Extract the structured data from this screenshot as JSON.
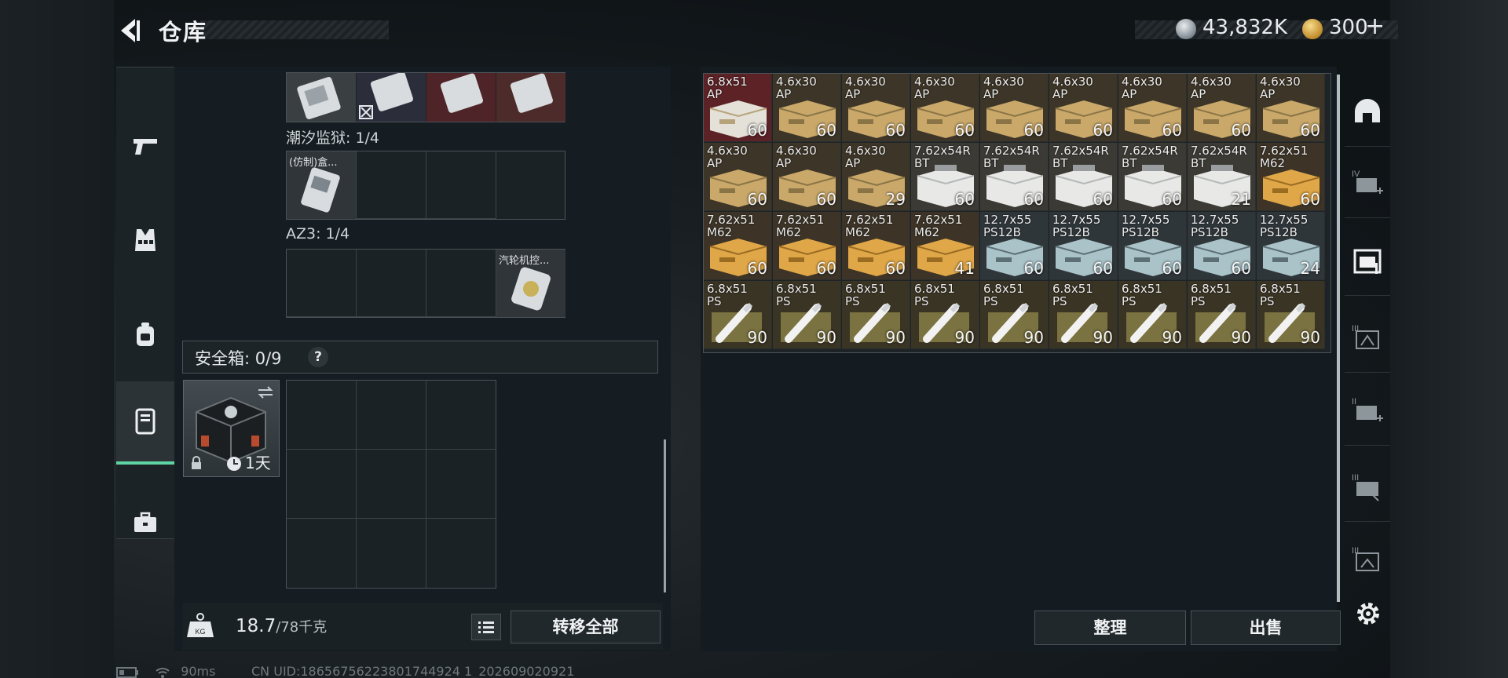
{
  "header": {
    "title": "仓库",
    "currency_silver": "43,832K",
    "currency_gold": "300",
    "gold_plus": "+"
  },
  "containers": {
    "tide_prison_label": "潮汐监狱: 1/4",
    "tide_item_label": "(仿制)盒...",
    "az3_label": "AZ3: 1/4",
    "az3_item_label": "汽轮机控..."
  },
  "safe_box": {
    "label": "安全箱: 0/9",
    "help": "?",
    "timer": "1天"
  },
  "bottom_left": {
    "weight_current": "18.7",
    "weight_max": "/78千克",
    "kg_badge": "KG",
    "transfer_all": "转移全部"
  },
  "bottom_right": {
    "organize": "整理",
    "sell": "出售"
  },
  "status": {
    "ping": "90ms",
    "uid": "CN UID:18656756223801744924 1_202609020921"
  },
  "stash": {
    "rows": [
      [
        {
          "cal": "6.8x51",
          "sub": "AP",
          "count": "60",
          "kind": "red"
        },
        {
          "cal": "4.6x30",
          "sub": "AP",
          "count": "60",
          "kind": "tan"
        },
        {
          "cal": "4.6x30",
          "sub": "AP",
          "count": "60",
          "kind": "tan"
        },
        {
          "cal": "4.6x30",
          "sub": "AP",
          "count": "60",
          "kind": "tan"
        },
        {
          "cal": "4.6x30",
          "sub": "AP",
          "count": "60",
          "kind": "tan"
        },
        {
          "cal": "4.6x30",
          "sub": "AP",
          "count": "60",
          "kind": "tan"
        },
        {
          "cal": "4.6x30",
          "sub": "AP",
          "count": "60",
          "kind": "tan"
        },
        {
          "cal": "4.6x30",
          "sub": "AP",
          "count": "60",
          "kind": "tan"
        },
        {
          "cal": "4.6x30",
          "sub": "AP",
          "count": "60",
          "kind": "tan"
        }
      ],
      [
        {
          "cal": "4.6x30",
          "sub": "AP",
          "count": "60",
          "kind": "tan"
        },
        {
          "cal": "4.6x30",
          "sub": "AP",
          "count": "60",
          "kind": "tan"
        },
        {
          "cal": "4.6x30",
          "sub": "AP",
          "count": "29",
          "kind": "tan"
        },
        {
          "cal": "7.62x54R",
          "sub": "BT",
          "count": "60",
          "kind": "white"
        },
        {
          "cal": "7.62x54R",
          "sub": "BT",
          "count": "60",
          "kind": "white"
        },
        {
          "cal": "7.62x54R",
          "sub": "BT",
          "count": "60",
          "kind": "white"
        },
        {
          "cal": "7.62x54R",
          "sub": "BT",
          "count": "60",
          "kind": "white"
        },
        {
          "cal": "7.62x54R",
          "sub": "BT",
          "count": "21",
          "kind": "white"
        },
        {
          "cal": "7.62x51",
          "sub": "M62",
          "count": "60",
          "kind": "yellow"
        }
      ],
      [
        {
          "cal": "7.62x51",
          "sub": "M62",
          "count": "60",
          "kind": "yellow"
        },
        {
          "cal": "7.62x51",
          "sub": "M62",
          "count": "60",
          "kind": "yellow"
        },
        {
          "cal": "7.62x51",
          "sub": "M62",
          "count": "60",
          "kind": "yellow"
        },
        {
          "cal": "7.62x51",
          "sub": "M62",
          "count": "41",
          "kind": "yellow"
        },
        {
          "cal": "12.7x55",
          "sub": "PS12B",
          "count": "60",
          "kind": "blue"
        },
        {
          "cal": "12.7x55",
          "sub": "PS12B",
          "count": "60",
          "kind": "blue"
        },
        {
          "cal": "12.7x55",
          "sub": "PS12B",
          "count": "60",
          "kind": "blue"
        },
        {
          "cal": "12.7x55",
          "sub": "PS12B",
          "count": "60",
          "kind": "blue"
        },
        {
          "cal": "12.7x55",
          "sub": "PS12B",
          "count": "24",
          "kind": "blue"
        }
      ],
      [
        {
          "cal": "6.8x51",
          "sub": "PS",
          "count": "90",
          "kind": "olive"
        },
        {
          "cal": "6.8x51",
          "sub": "PS",
          "count": "90",
          "kind": "olive"
        },
        {
          "cal": "6.8x51",
          "sub": "PS",
          "count": "90",
          "kind": "olive"
        },
        {
          "cal": "6.8x51",
          "sub": "PS",
          "count": "90",
          "kind": "olive"
        },
        {
          "cal": "6.8x51",
          "sub": "PS",
          "count": "90",
          "kind": "olive"
        },
        {
          "cal": "6.8x51",
          "sub": "PS",
          "count": "90",
          "kind": "olive"
        },
        {
          "cal": "6.8x51",
          "sub": "PS",
          "count": "90",
          "kind": "olive"
        },
        {
          "cal": "6.8x51",
          "sub": "PS",
          "count": "90",
          "kind": "olive"
        },
        {
          "cal": "6.8x51",
          "sub": "PS",
          "count": "90",
          "kind": "olive"
        }
      ]
    ]
  },
  "nav": {
    "icons": [
      "pistol-icon",
      "vest-icon",
      "backpack-icon",
      "safe-box-icon",
      "briefcase-icon"
    ],
    "active_index": 3
  },
  "rail": {
    "icons": [
      "helmet-icon",
      "tier-4-medkit-icon",
      "stash-folder-icon",
      "tier-3-map-icon",
      "tier-2-medkit-icon",
      "tier-3-key-icon",
      "tier-3-map-alt-icon"
    ],
    "labels": [
      "",
      "IV",
      "",
      "III",
      "II",
      "III",
      "III"
    ],
    "active_index": 2
  },
  "colors": {
    "accent_green": "#5fd3a4",
    "red_tile": "#6a2226",
    "tan_box": "#c9a86a",
    "white_box": "#e8e8e6",
    "yellow_box": "#e0a748",
    "blue_box": "#a9c3c9"
  }
}
